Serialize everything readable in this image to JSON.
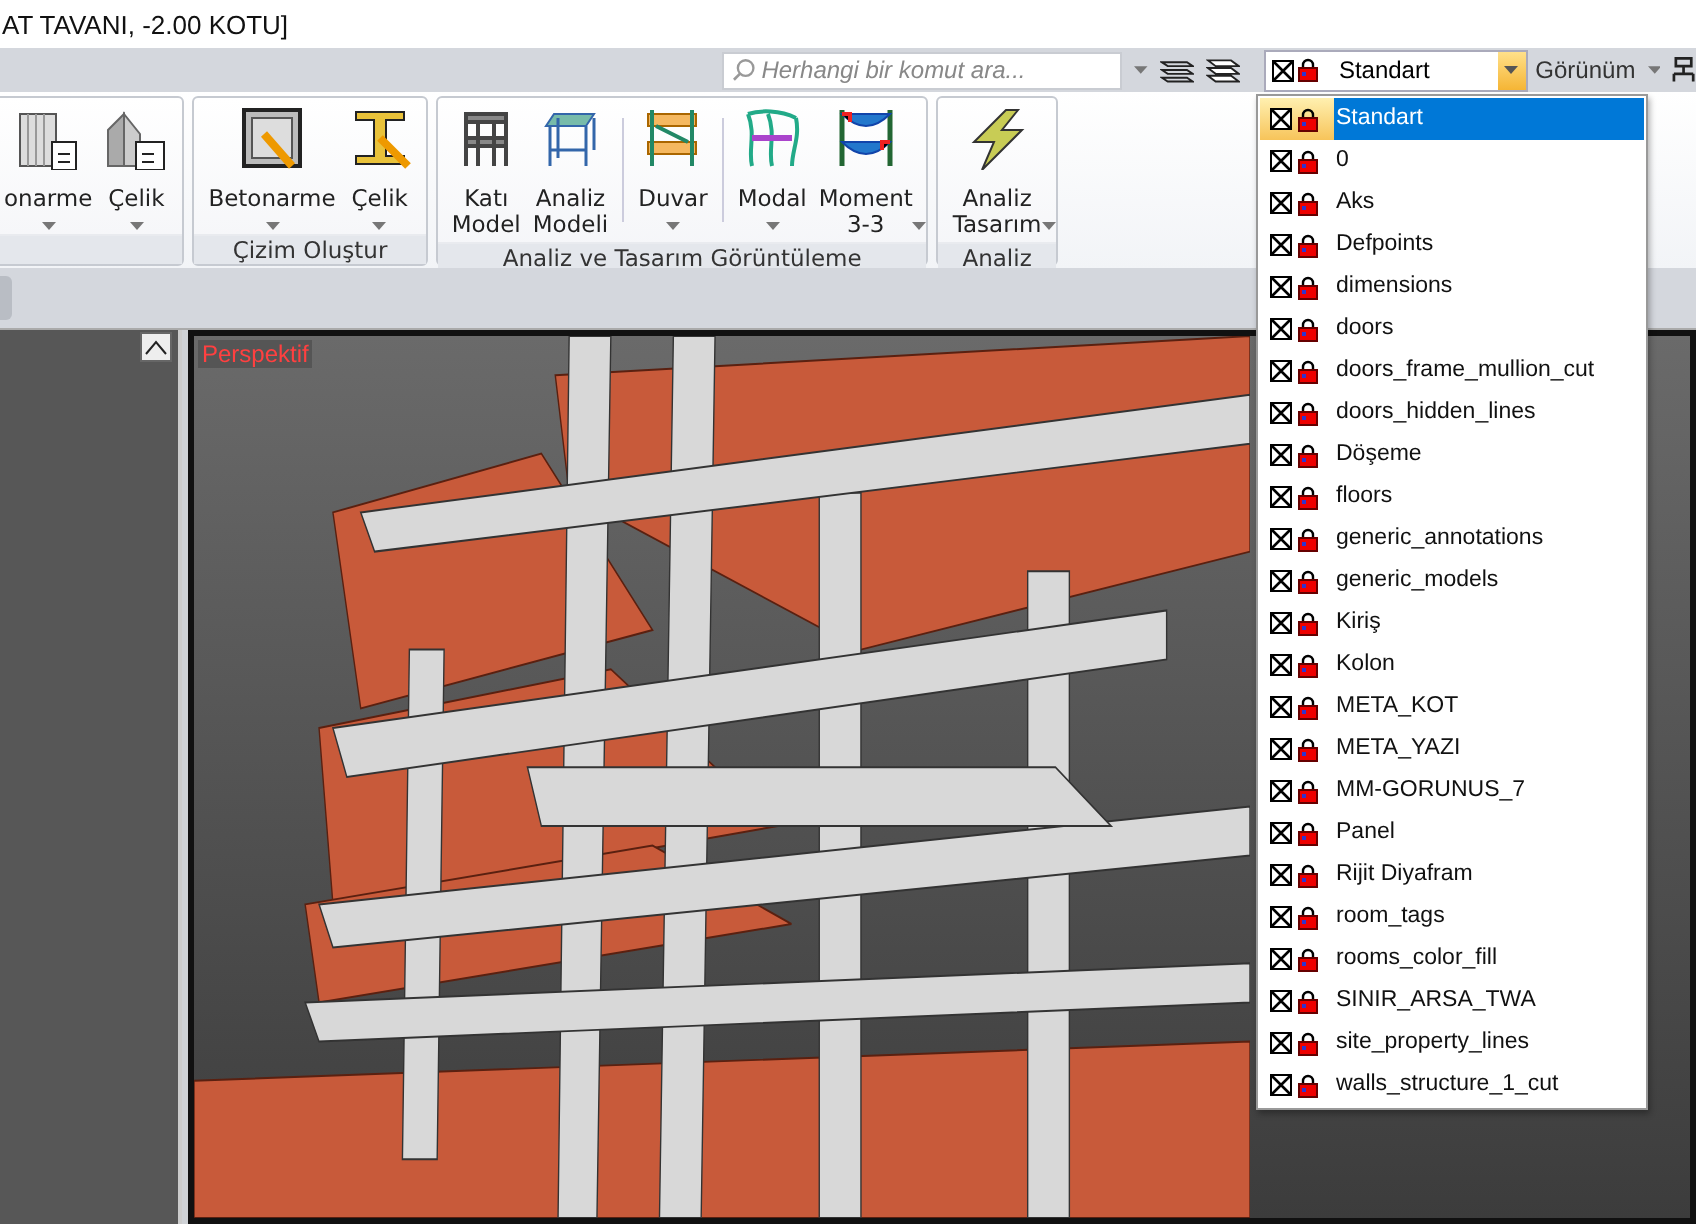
{
  "window": {
    "title": "AT TAVANI, -2.00 KOTU]"
  },
  "toolbar": {
    "search": {
      "placeholder": "Herhangi bir komut ara..."
    },
    "layer_combo": {
      "value": "Standart"
    },
    "view_menu": {
      "label": "Görünüm"
    }
  },
  "ribbon": {
    "groups": [
      {
        "buttons": [
          {
            "kind": "wall-beton",
            "lines": [
              "onarme"
            ],
            "dropdown": true
          },
          {
            "kind": "wall-steel",
            "lines": [
              "Çelik"
            ],
            "dropdown": true
          }
        ]
      },
      {
        "label": "Çizim Oluştur",
        "buttons": [
          {
            "kind": "draw-beton",
            "lines": [
              "Betonarme"
            ],
            "dropdown": true
          },
          {
            "kind": "draw-steel",
            "lines": [
              "Çelik"
            ],
            "dropdown": true
          }
        ]
      },
      {
        "label": "Analiz ve Tasarım Görüntüleme",
        "buttons": [
          {
            "kind": "solid",
            "lines": [
              "Katı",
              "Model"
            ],
            "dropdown": false
          },
          {
            "kind": "analysis",
            "lines": [
              "Analiz",
              "Modeli"
            ],
            "dropdown": false
          },
          {
            "kind": "separator"
          },
          {
            "kind": "wall",
            "lines": [
              "Duvar"
            ],
            "dropdown": true
          },
          {
            "kind": "separator"
          },
          {
            "kind": "modal",
            "lines": [
              "Modal"
            ],
            "dropdown": true
          },
          {
            "kind": "moment",
            "lines": [
              "Moment",
              "3-3"
            ],
            "dropdown": true
          }
        ]
      },
      {
        "label": "Analiz",
        "buttons": [
          {
            "kind": "bolt",
            "lines": [
              "Analiz",
              "Tasarım"
            ],
            "dropdown": true
          }
        ]
      }
    ]
  },
  "viewport": {
    "label": "Perspektif"
  },
  "layers": [
    {
      "name": "Standart",
      "selected": true
    },
    {
      "name": "0",
      "selected": false
    },
    {
      "name": "Aks",
      "selected": false
    },
    {
      "name": "Defpoints",
      "selected": false
    },
    {
      "name": "dimensions",
      "selected": false
    },
    {
      "name": "doors",
      "selected": false
    },
    {
      "name": "doors_frame_mullion_cut",
      "selected": false
    },
    {
      "name": "doors_hidden_lines",
      "selected": false
    },
    {
      "name": "Döşeme",
      "selected": false
    },
    {
      "name": "floors",
      "selected": false
    },
    {
      "name": "generic_annotations",
      "selected": false
    },
    {
      "name": "generic_models",
      "selected": false
    },
    {
      "name": "Kiriş",
      "selected": false
    },
    {
      "name": "Kolon",
      "selected": false
    },
    {
      "name": "META_KOT",
      "selected": false
    },
    {
      "name": "META_YAZI",
      "selected": false
    },
    {
      "name": "MM-GORUNUS_7",
      "selected": false
    },
    {
      "name": "Panel",
      "selected": false
    },
    {
      "name": "Rijit Diyafram",
      "selected": false
    },
    {
      "name": "room_tags",
      "selected": false
    },
    {
      "name": "rooms_color_fill",
      "selected": false
    },
    {
      "name": "SINIR_ARSA_TWA",
      "selected": false
    },
    {
      "name": "site_property_lines",
      "selected": false
    },
    {
      "name": "walls_structure_1_cut",
      "selected": false
    }
  ]
}
